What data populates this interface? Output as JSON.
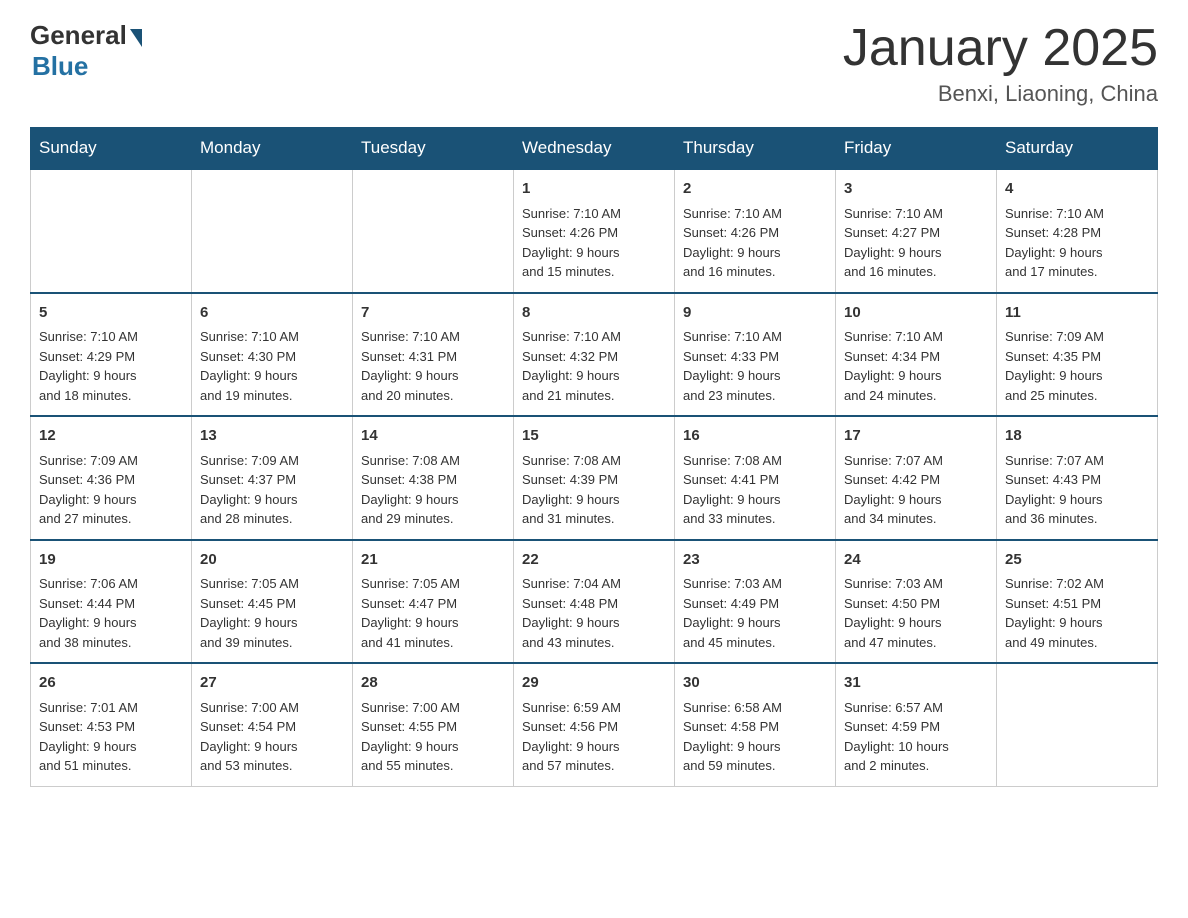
{
  "header": {
    "logo": {
      "general": "General",
      "blue": "Blue"
    },
    "title": "January 2025",
    "location": "Benxi, Liaoning, China"
  },
  "days_of_week": [
    "Sunday",
    "Monday",
    "Tuesday",
    "Wednesday",
    "Thursday",
    "Friday",
    "Saturday"
  ],
  "weeks": [
    [
      {
        "day": "",
        "info": ""
      },
      {
        "day": "",
        "info": ""
      },
      {
        "day": "",
        "info": ""
      },
      {
        "day": "1",
        "info": "Sunrise: 7:10 AM\nSunset: 4:26 PM\nDaylight: 9 hours\nand 15 minutes."
      },
      {
        "day": "2",
        "info": "Sunrise: 7:10 AM\nSunset: 4:26 PM\nDaylight: 9 hours\nand 16 minutes."
      },
      {
        "day": "3",
        "info": "Sunrise: 7:10 AM\nSunset: 4:27 PM\nDaylight: 9 hours\nand 16 minutes."
      },
      {
        "day": "4",
        "info": "Sunrise: 7:10 AM\nSunset: 4:28 PM\nDaylight: 9 hours\nand 17 minutes."
      }
    ],
    [
      {
        "day": "5",
        "info": "Sunrise: 7:10 AM\nSunset: 4:29 PM\nDaylight: 9 hours\nand 18 minutes."
      },
      {
        "day": "6",
        "info": "Sunrise: 7:10 AM\nSunset: 4:30 PM\nDaylight: 9 hours\nand 19 minutes."
      },
      {
        "day": "7",
        "info": "Sunrise: 7:10 AM\nSunset: 4:31 PM\nDaylight: 9 hours\nand 20 minutes."
      },
      {
        "day": "8",
        "info": "Sunrise: 7:10 AM\nSunset: 4:32 PM\nDaylight: 9 hours\nand 21 minutes."
      },
      {
        "day": "9",
        "info": "Sunrise: 7:10 AM\nSunset: 4:33 PM\nDaylight: 9 hours\nand 23 minutes."
      },
      {
        "day": "10",
        "info": "Sunrise: 7:10 AM\nSunset: 4:34 PM\nDaylight: 9 hours\nand 24 minutes."
      },
      {
        "day": "11",
        "info": "Sunrise: 7:09 AM\nSunset: 4:35 PM\nDaylight: 9 hours\nand 25 minutes."
      }
    ],
    [
      {
        "day": "12",
        "info": "Sunrise: 7:09 AM\nSunset: 4:36 PM\nDaylight: 9 hours\nand 27 minutes."
      },
      {
        "day": "13",
        "info": "Sunrise: 7:09 AM\nSunset: 4:37 PM\nDaylight: 9 hours\nand 28 minutes."
      },
      {
        "day": "14",
        "info": "Sunrise: 7:08 AM\nSunset: 4:38 PM\nDaylight: 9 hours\nand 29 minutes."
      },
      {
        "day": "15",
        "info": "Sunrise: 7:08 AM\nSunset: 4:39 PM\nDaylight: 9 hours\nand 31 minutes."
      },
      {
        "day": "16",
        "info": "Sunrise: 7:08 AM\nSunset: 4:41 PM\nDaylight: 9 hours\nand 33 minutes."
      },
      {
        "day": "17",
        "info": "Sunrise: 7:07 AM\nSunset: 4:42 PM\nDaylight: 9 hours\nand 34 minutes."
      },
      {
        "day": "18",
        "info": "Sunrise: 7:07 AM\nSunset: 4:43 PM\nDaylight: 9 hours\nand 36 minutes."
      }
    ],
    [
      {
        "day": "19",
        "info": "Sunrise: 7:06 AM\nSunset: 4:44 PM\nDaylight: 9 hours\nand 38 minutes."
      },
      {
        "day": "20",
        "info": "Sunrise: 7:05 AM\nSunset: 4:45 PM\nDaylight: 9 hours\nand 39 minutes."
      },
      {
        "day": "21",
        "info": "Sunrise: 7:05 AM\nSunset: 4:47 PM\nDaylight: 9 hours\nand 41 minutes."
      },
      {
        "day": "22",
        "info": "Sunrise: 7:04 AM\nSunset: 4:48 PM\nDaylight: 9 hours\nand 43 minutes."
      },
      {
        "day": "23",
        "info": "Sunrise: 7:03 AM\nSunset: 4:49 PM\nDaylight: 9 hours\nand 45 minutes."
      },
      {
        "day": "24",
        "info": "Sunrise: 7:03 AM\nSunset: 4:50 PM\nDaylight: 9 hours\nand 47 minutes."
      },
      {
        "day": "25",
        "info": "Sunrise: 7:02 AM\nSunset: 4:51 PM\nDaylight: 9 hours\nand 49 minutes."
      }
    ],
    [
      {
        "day": "26",
        "info": "Sunrise: 7:01 AM\nSunset: 4:53 PM\nDaylight: 9 hours\nand 51 minutes."
      },
      {
        "day": "27",
        "info": "Sunrise: 7:00 AM\nSunset: 4:54 PM\nDaylight: 9 hours\nand 53 minutes."
      },
      {
        "day": "28",
        "info": "Sunrise: 7:00 AM\nSunset: 4:55 PM\nDaylight: 9 hours\nand 55 minutes."
      },
      {
        "day": "29",
        "info": "Sunrise: 6:59 AM\nSunset: 4:56 PM\nDaylight: 9 hours\nand 57 minutes."
      },
      {
        "day": "30",
        "info": "Sunrise: 6:58 AM\nSunset: 4:58 PM\nDaylight: 9 hours\nand 59 minutes."
      },
      {
        "day": "31",
        "info": "Sunrise: 6:57 AM\nSunset: 4:59 PM\nDaylight: 10 hours\nand 2 minutes."
      },
      {
        "day": "",
        "info": ""
      }
    ]
  ]
}
